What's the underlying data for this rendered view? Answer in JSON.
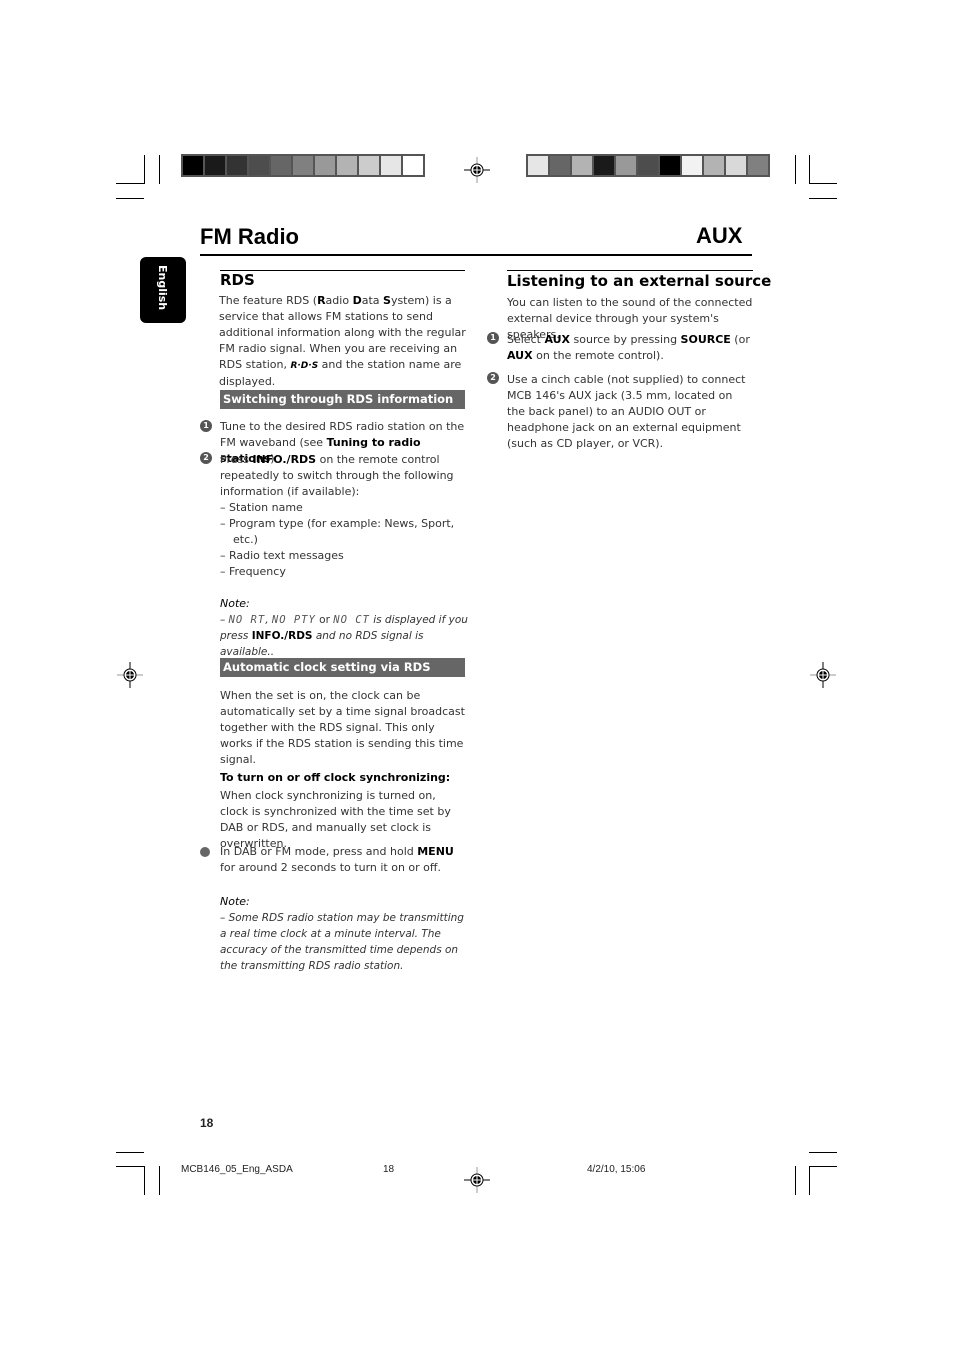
{
  "header": {
    "left_title": "FM Radio",
    "right_title": "AUX",
    "language_tab": "English"
  },
  "color_bars": {
    "left": [
      "#000000",
      "#1a1a1a",
      "#333333",
      "#4d4d4d",
      "#666666",
      "#808080",
      "#999999",
      "#b3b3b3",
      "#cccccc",
      "#e6e6e6",
      "#ffffff"
    ],
    "right": [
      "#e6e6e6",
      "#666666",
      "#b3b3b3",
      "#1a1a1a",
      "#999999",
      "#4d4d4d",
      "#000000",
      "#f2f2f2",
      "#b3b3b3",
      "#d9d9d9",
      "#808080"
    ]
  },
  "rds": {
    "heading": "RDS",
    "intro_pre": "The feature RDS (",
    "intro_r": "R",
    "intro_adio": "adio ",
    "intro_d": "D",
    "intro_ata": "ata ",
    "intro_s": "S",
    "intro_post": "ystem) is a service that allows FM stations to send additional information along with the regular FM radio signal. When you are receiving an RDS station, ",
    "rds_logo": "R·D·S",
    "intro_end": " and the station name are displayed.",
    "switching": {
      "band_title": "Switching through RDS information",
      "step1_num": "1",
      "step1_text": "Tune to the desired RDS radio station on the FM waveband (see ",
      "step1_bold": "Tuning to radio stations",
      "step1_end": ")",
      "step2_num": "2",
      "step2_pre": "Press ",
      "step2_bold": "INFO./RDS",
      "step2_text": " on the remote control repeatedly to switch through the following information (if available):",
      "list": [
        "–  Station name",
        "–  Program type (for example: News, Sport, etc.)",
        "–  Radio text messages",
        "–  Frequency"
      ],
      "note_label": "Note:",
      "note_dash": "– ",
      "note_lcd1": "NO RT",
      "note_comma": ", ",
      "note_lcd2": "NO PTY",
      "note_or": " or ",
      "note_lcd3": "NO CT",
      "note_mid": " is displayed if you press ",
      "note_bold": "INFO./RDS",
      "note_end": " and no RDS signal is available.."
    },
    "clock": {
      "band_title": "Automatic clock setting via RDS",
      "intro": "When the set is on, the clock can be automatically set by a time signal broadcast together with the RDS signal. This only works if the RDS station is sending this time signal.",
      "sub_heading": "To turn on or off clock synchronizing:",
      "sub_text": "When clock synchronizing is turned on, clock is synchronized with the time set by DAB or RDS, and manually set clock is overwritten.",
      "bullet_pre": "In DAB or FM mode, press and hold ",
      "bullet_bold": "MENU",
      "bullet_end": " for around 2 seconds to turn it on or off.",
      "note_label": "Note:",
      "note_text": "–  Some RDS radio station may be transmitting a real time clock at a minute interval. The accuracy of the transmitted time depends on the transmitting RDS radio station."
    }
  },
  "aux": {
    "heading": "Listening to an external source",
    "intro": "You can listen to the sound of the connected external device through your system's speakers.",
    "step1_num": "1",
    "step1_pre": "Select ",
    "step1_b1": "AUX",
    "step1_mid": " source by pressing ",
    "step1_b2": "SOURCE",
    "step1_mid2": " (or ",
    "step1_b3": "AUX",
    "step1_end": " on the remote control).",
    "step2_num": "2",
    "step2_text": "Use a cinch cable (not supplied) to connect MCB 146's AUX jack (3.5 mm, located on the back panel) to an AUDIO OUT or headphone jack on an external equipment (such as CD player, or VCR)."
  },
  "footer": {
    "page_number": "18",
    "file_name": "MCB146_05_Eng_ASDA",
    "file_page": "18",
    "timestamp": "4/2/10, 15:06"
  }
}
